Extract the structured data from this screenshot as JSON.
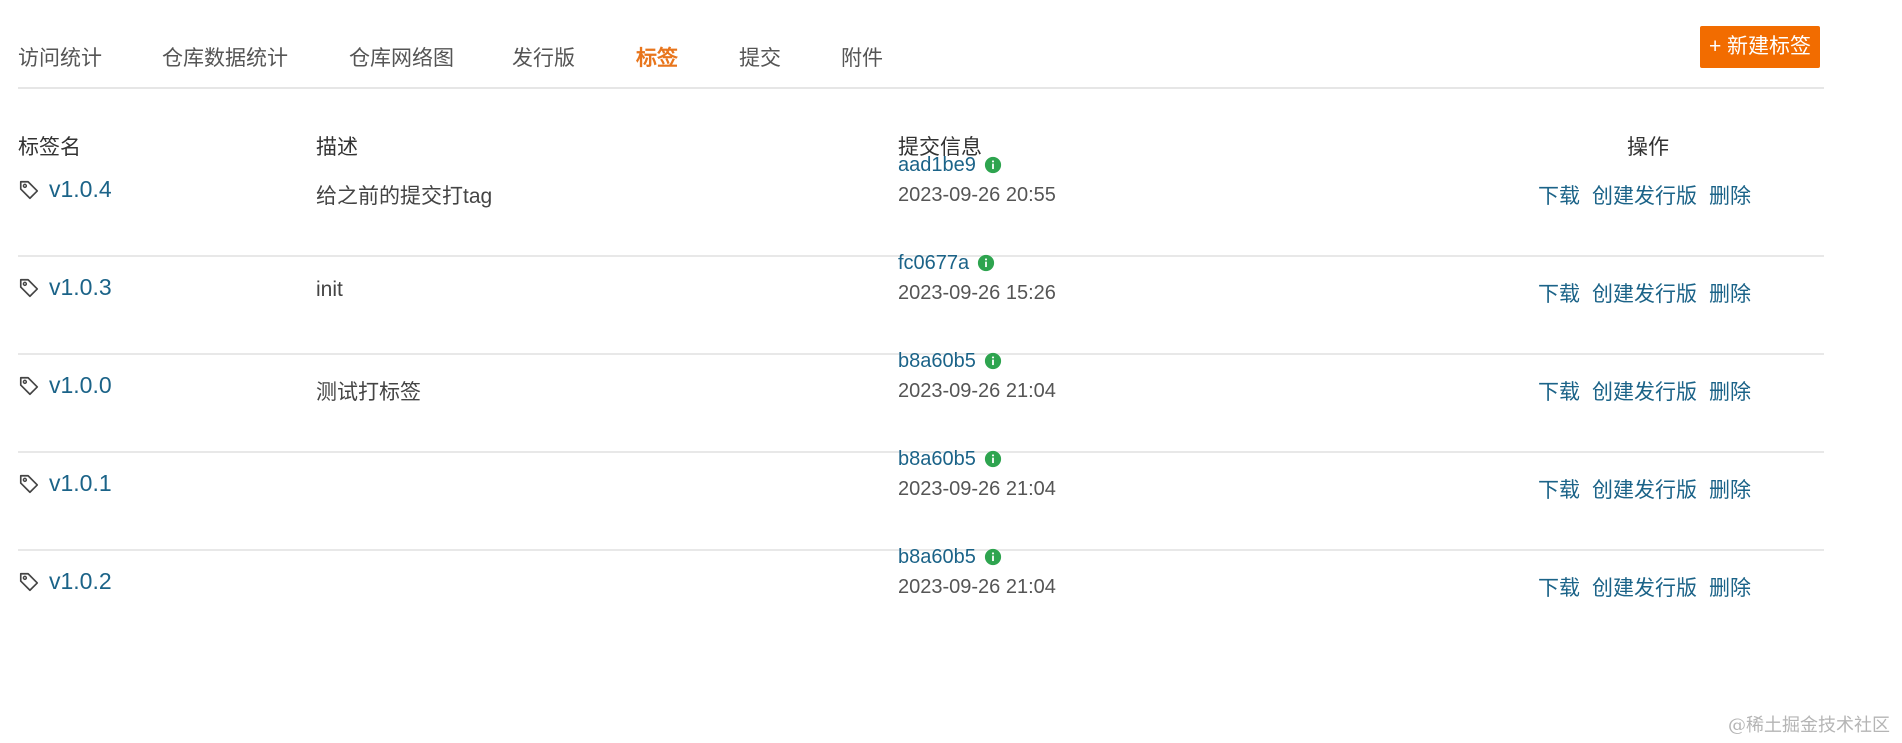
{
  "tabs": [
    {
      "label": "访问统计",
      "active": false
    },
    {
      "label": "仓库数据统计",
      "active": false
    },
    {
      "label": "仓库网络图",
      "active": false
    },
    {
      "label": "发行版",
      "active": false
    },
    {
      "label": "标签",
      "active": true
    },
    {
      "label": "提交",
      "active": false
    },
    {
      "label": "附件",
      "active": false
    }
  ],
  "new_tag_button": "+ 新建标签",
  "table": {
    "headers": {
      "tag": "标签名",
      "desc": "描述",
      "commit": "提交信息",
      "ops": "操作"
    },
    "rows": [
      {
        "tag": "v1.0.4",
        "desc": "给之前的提交打tag",
        "sha": "aad1be9",
        "time": "2023-09-26 20:55"
      },
      {
        "tag": "v1.0.3",
        "desc": "init",
        "sha": "fc0677a",
        "time": "2023-09-26 15:26"
      },
      {
        "tag": "v1.0.0",
        "desc": "测试打标签",
        "sha": "b8a60b5",
        "time": "2023-09-26 21:04"
      },
      {
        "tag": "v1.0.1",
        "desc": "",
        "sha": "b8a60b5",
        "time": "2023-09-26 21:04"
      },
      {
        "tag": "v1.0.2",
        "desc": "",
        "sha": "b8a60b5",
        "time": "2023-09-26 21:04"
      }
    ],
    "op_labels": {
      "download": "下载",
      "create_release": "创建发行版",
      "delete": "删除"
    }
  },
  "icons": {
    "tag": "tag-icon",
    "info": "info-icon"
  },
  "colors": {
    "accent": "#f26c00",
    "active_tab": "#e8751c",
    "link": "#1b6388",
    "info_badge": "#2ea44f"
  },
  "watermark": "@稀土掘金技术社区"
}
